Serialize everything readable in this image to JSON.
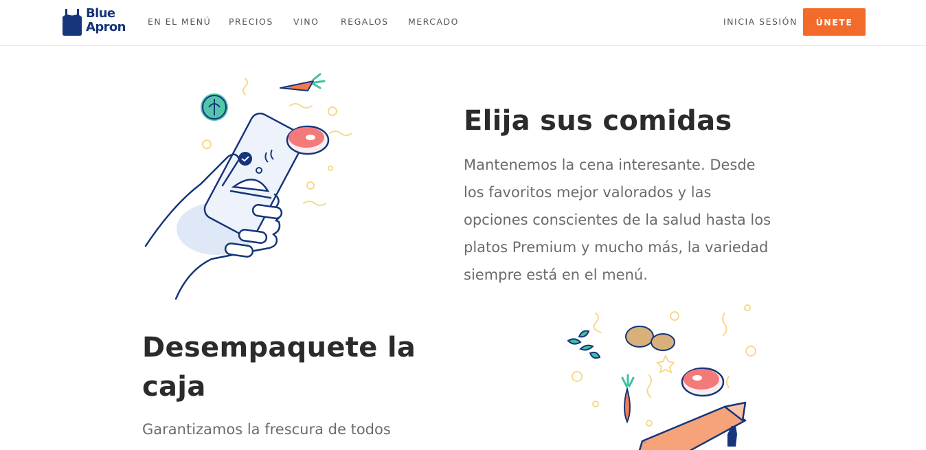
{
  "brand": {
    "line1": "Blue",
    "line2": "Apron",
    "color": "#16357a"
  },
  "nav": {
    "items": [
      {
        "label": "EN EL MENÚ"
      },
      {
        "label": "PRECIOS"
      },
      {
        "label": "VINO"
      },
      {
        "label": "REGALOS"
      },
      {
        "label": "MERCADO"
      }
    ],
    "login_label": "INICIA SESIÓN",
    "join_label": "ÚNETE",
    "join_color": "#f26b2b"
  },
  "section1": {
    "title": "Elija sus comidas",
    "body": "Mantenemos la cena interesante. Desde los favoritos mejor valorados y las opciones conscientes de la salud hasta los platos Premium y mucho más, la variedad siempre está en el menú.",
    "illustration": "phone-hand-icon"
  },
  "section2": {
    "title": "Desempaquete la caja",
    "body": "Garantizamos la frescura de todos",
    "illustration": "open-box-ingredients-icon"
  },
  "colors": {
    "heading": "#2b2b2b",
    "body_text": "#6b6b6b",
    "navy": "#16357a",
    "accent_orange": "#f26b2b"
  }
}
